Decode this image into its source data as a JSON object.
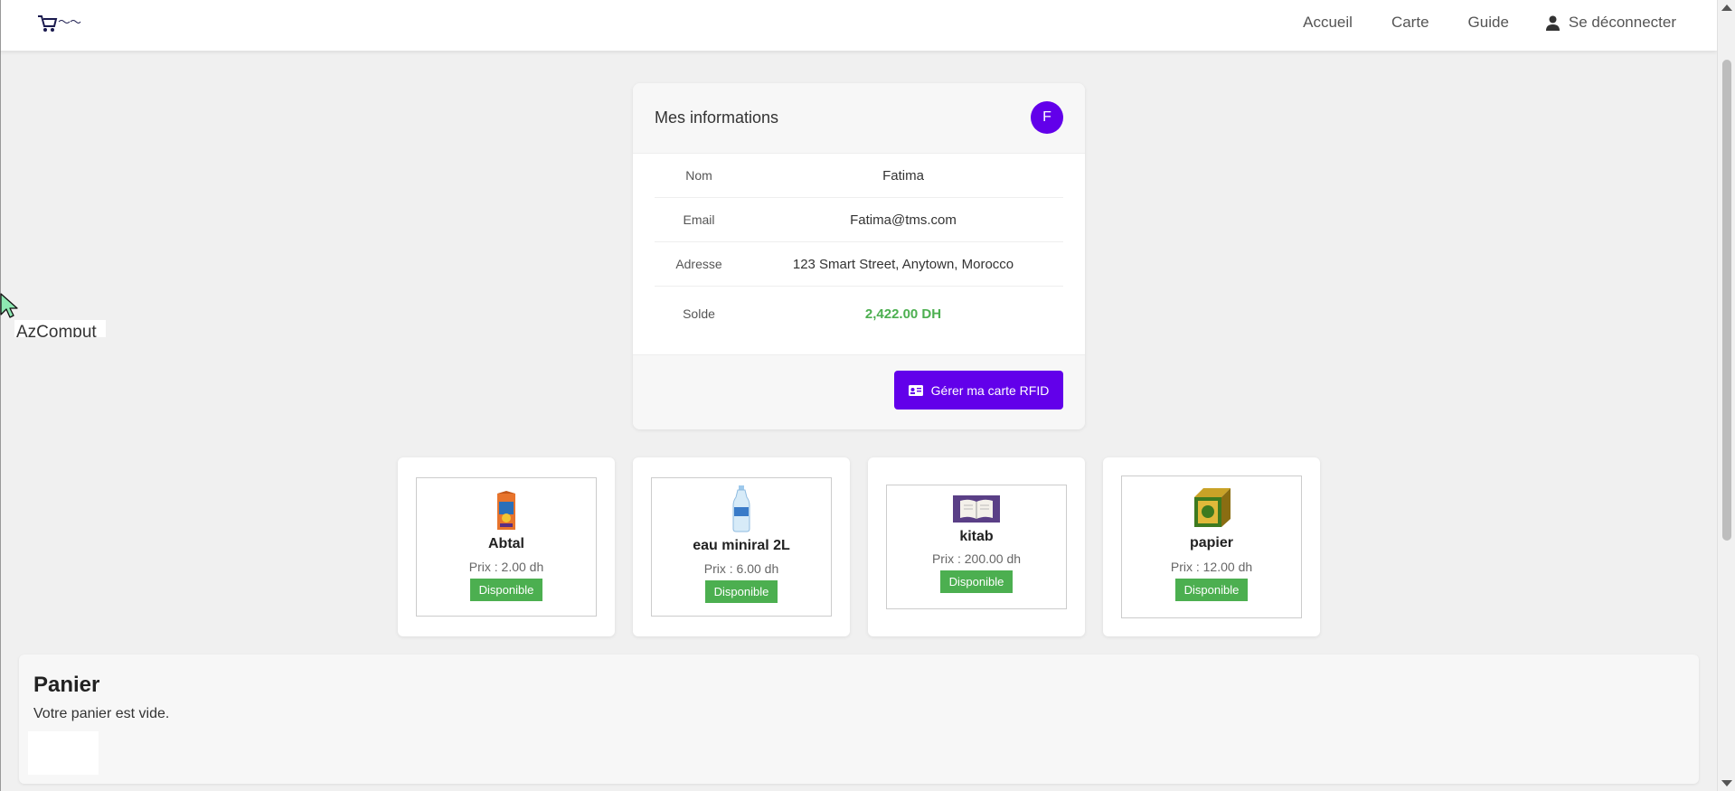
{
  "navbar": {
    "links": [
      "Accueil",
      "Carte",
      "Guide"
    ],
    "logout_label": "Se déconnecter"
  },
  "info": {
    "title": "Mes informations",
    "avatar_letter": "F",
    "rows": [
      {
        "label": "Nom",
        "value": "Fatima"
      },
      {
        "label": "Email",
        "value": "Fatima@tms.com"
      },
      {
        "label": "Adresse",
        "value": "123 Smart Street, Anytown, Morocco"
      },
      {
        "label": "Solde",
        "value": "2,422.00 DH"
      }
    ],
    "rfid_button": "Gérer ma carte RFID"
  },
  "products": [
    {
      "name": "Abtal",
      "price": "Prix : 2.00 dh",
      "status": "Disponible",
      "icon": "juice-box-icon"
    },
    {
      "name": "eau miniral 2L",
      "price": "Prix : 6.00 dh",
      "status": "Disponible",
      "icon": "water-bottle-icon"
    },
    {
      "name": "kitab",
      "price": "Prix : 200.00 dh",
      "status": "Disponible",
      "icon": "book-icon"
    },
    {
      "name": "papier",
      "price": "Prix : 12.00 dh",
      "status": "Disponible",
      "icon": "tea-box-icon"
    }
  ],
  "panier": {
    "title": "Panier",
    "empty_message": "Votre panier est vide."
  },
  "overlay": {
    "text": "AzComput"
  },
  "colors": {
    "accent": "#6200ea",
    "success": "#4caf50"
  }
}
